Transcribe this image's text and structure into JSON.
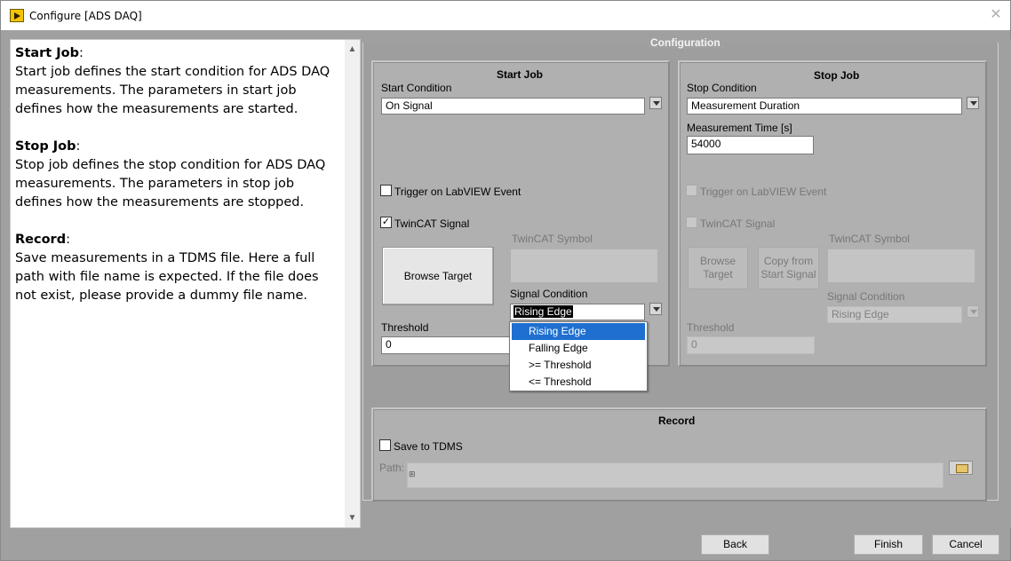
{
  "window": {
    "title": "Configure [ADS DAQ]",
    "close_glyph": "✕"
  },
  "help": {
    "sections": [
      {
        "heading": "Start Job",
        "body": "Start job defines the start condition for ADS DAQ measurements. The parameters in start job defines how the measurements are started."
      },
      {
        "heading": "Stop Job",
        "body": "Stop job defines the stop condition for ADS DAQ measurements. The parameters in stop job defines how the measurements are stopped."
      },
      {
        "heading": "Record",
        "body": "Save measurements in a TDMS file. Here a full path with file name is expected. If the file does not exist, please provide a dummy file name."
      }
    ],
    "scroll_up": "▲",
    "scroll_down": "▼"
  },
  "config": {
    "title": "Configuration",
    "start_job": {
      "title": "Start Job",
      "start_condition_label": "Start Condition",
      "start_condition_value": "On Signal",
      "trigger_labview_label": "Trigger on LabVIEW Event",
      "trigger_labview_checked": false,
      "twincat_signal_label": "TwinCAT Signal",
      "twincat_signal_checked": true,
      "check_glyph": "✓",
      "browse_target_label": "Browse Target",
      "twincat_symbol_label": "TwinCAT Symbol",
      "signal_condition_label": "Signal Condition",
      "signal_condition_value": "Rising Edge",
      "threshold_label": "Threshold",
      "threshold_value": "0",
      "signal_condition_options": [
        "Rising Edge",
        "Falling Edge",
        ">= Threshold",
        "<= Threshold"
      ],
      "signal_condition_selected_index": 0
    },
    "stop_job": {
      "title": "Stop Job",
      "stop_condition_label": "Stop Condition",
      "stop_condition_value": "Measurement Duration",
      "measurement_time_label": "Measurement Time [s]",
      "measurement_time_value": "54000",
      "trigger_labview_label": "Trigger on LabVIEW Event",
      "twincat_signal_label": "TwinCAT Signal",
      "browse_target_label": "Browse Target",
      "copy_from_start_label": "Copy from Start Signal",
      "twincat_symbol_label": "TwinCAT Symbol",
      "signal_condition_label": "Signal Condition",
      "signal_condition_value": "Rising Edge",
      "threshold_label": "Threshold",
      "threshold_value": "0"
    },
    "record": {
      "title": "Record",
      "save_tdms_label": "Save to TDMS",
      "save_tdms_checked": false,
      "path_label": "Path:",
      "path_value": ""
    }
  },
  "footer": {
    "back_label": "Back",
    "finish_label": "Finish",
    "cancel_label": "Cancel"
  },
  "colors": {
    "panel_gray": "#a0a0a0",
    "group_gray": "#b0b0b0",
    "selection_blue": "#1e6fd0"
  }
}
